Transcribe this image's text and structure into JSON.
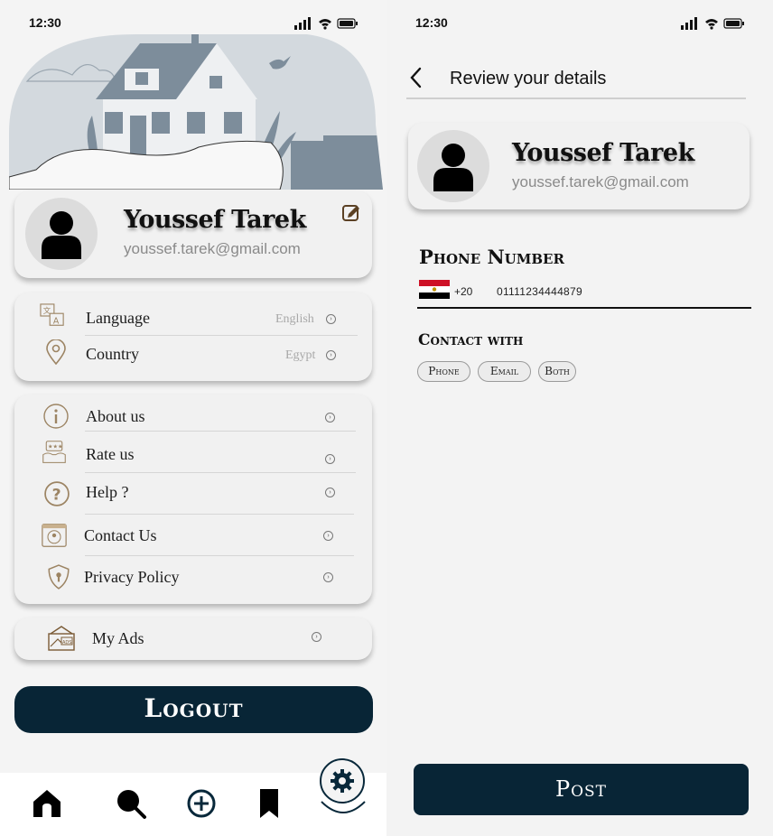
{
  "left_screen": {
    "status_bar": {
      "time": "12:30"
    },
    "profile": {
      "name": "Youssef Tarek",
      "email": "youssef.tarek@gmail.com",
      "edit_icon": "edit-icon"
    },
    "preferences": [
      {
        "icon": "translate-icon",
        "label": "Language",
        "value": "English"
      },
      {
        "icon": "location-pin-icon",
        "label": "Country",
        "value": "Egypt"
      }
    ],
    "info_items": [
      {
        "icon": "info-icon",
        "label": "About us"
      },
      {
        "icon": "rate-icon",
        "label": "Rate us"
      },
      {
        "icon": "help-icon",
        "label": "Help ?"
      },
      {
        "icon": "contact-icon",
        "label": "Contact Us"
      },
      {
        "icon": "shield-icon",
        "label": "Privacy Policy"
      }
    ],
    "my_ads": {
      "icon": "ads-icon",
      "label": "My Ads"
    },
    "logout_label": "Logout",
    "bottom_nav": [
      {
        "icon": "home-icon"
      },
      {
        "icon": "search-icon"
      },
      {
        "icon": "add-icon"
      },
      {
        "icon": "bookmark-icon"
      },
      {
        "icon": "settings-icon",
        "active": true
      }
    ]
  },
  "right_screen": {
    "status_bar": {
      "time": "12:30"
    },
    "header": {
      "title": "Review your details"
    },
    "profile": {
      "name": "Youssef Tarek",
      "email": "youssef.tarek@gmail.com"
    },
    "phone": {
      "title": "Phone Number",
      "country_flag": "egypt-flag-icon",
      "dial_code": "+20",
      "number": "01111234444879"
    },
    "contact_with": {
      "title": "Contact with",
      "options": [
        "Phone",
        "Email",
        "Both"
      ]
    },
    "post_label": "Post"
  },
  "colors": {
    "primary_dark": "#082536",
    "background": "#f4f4f4",
    "card": "#f1f1f1",
    "accent_brown": "#7a5a35",
    "illustration_slate": "#7d8d9b"
  }
}
